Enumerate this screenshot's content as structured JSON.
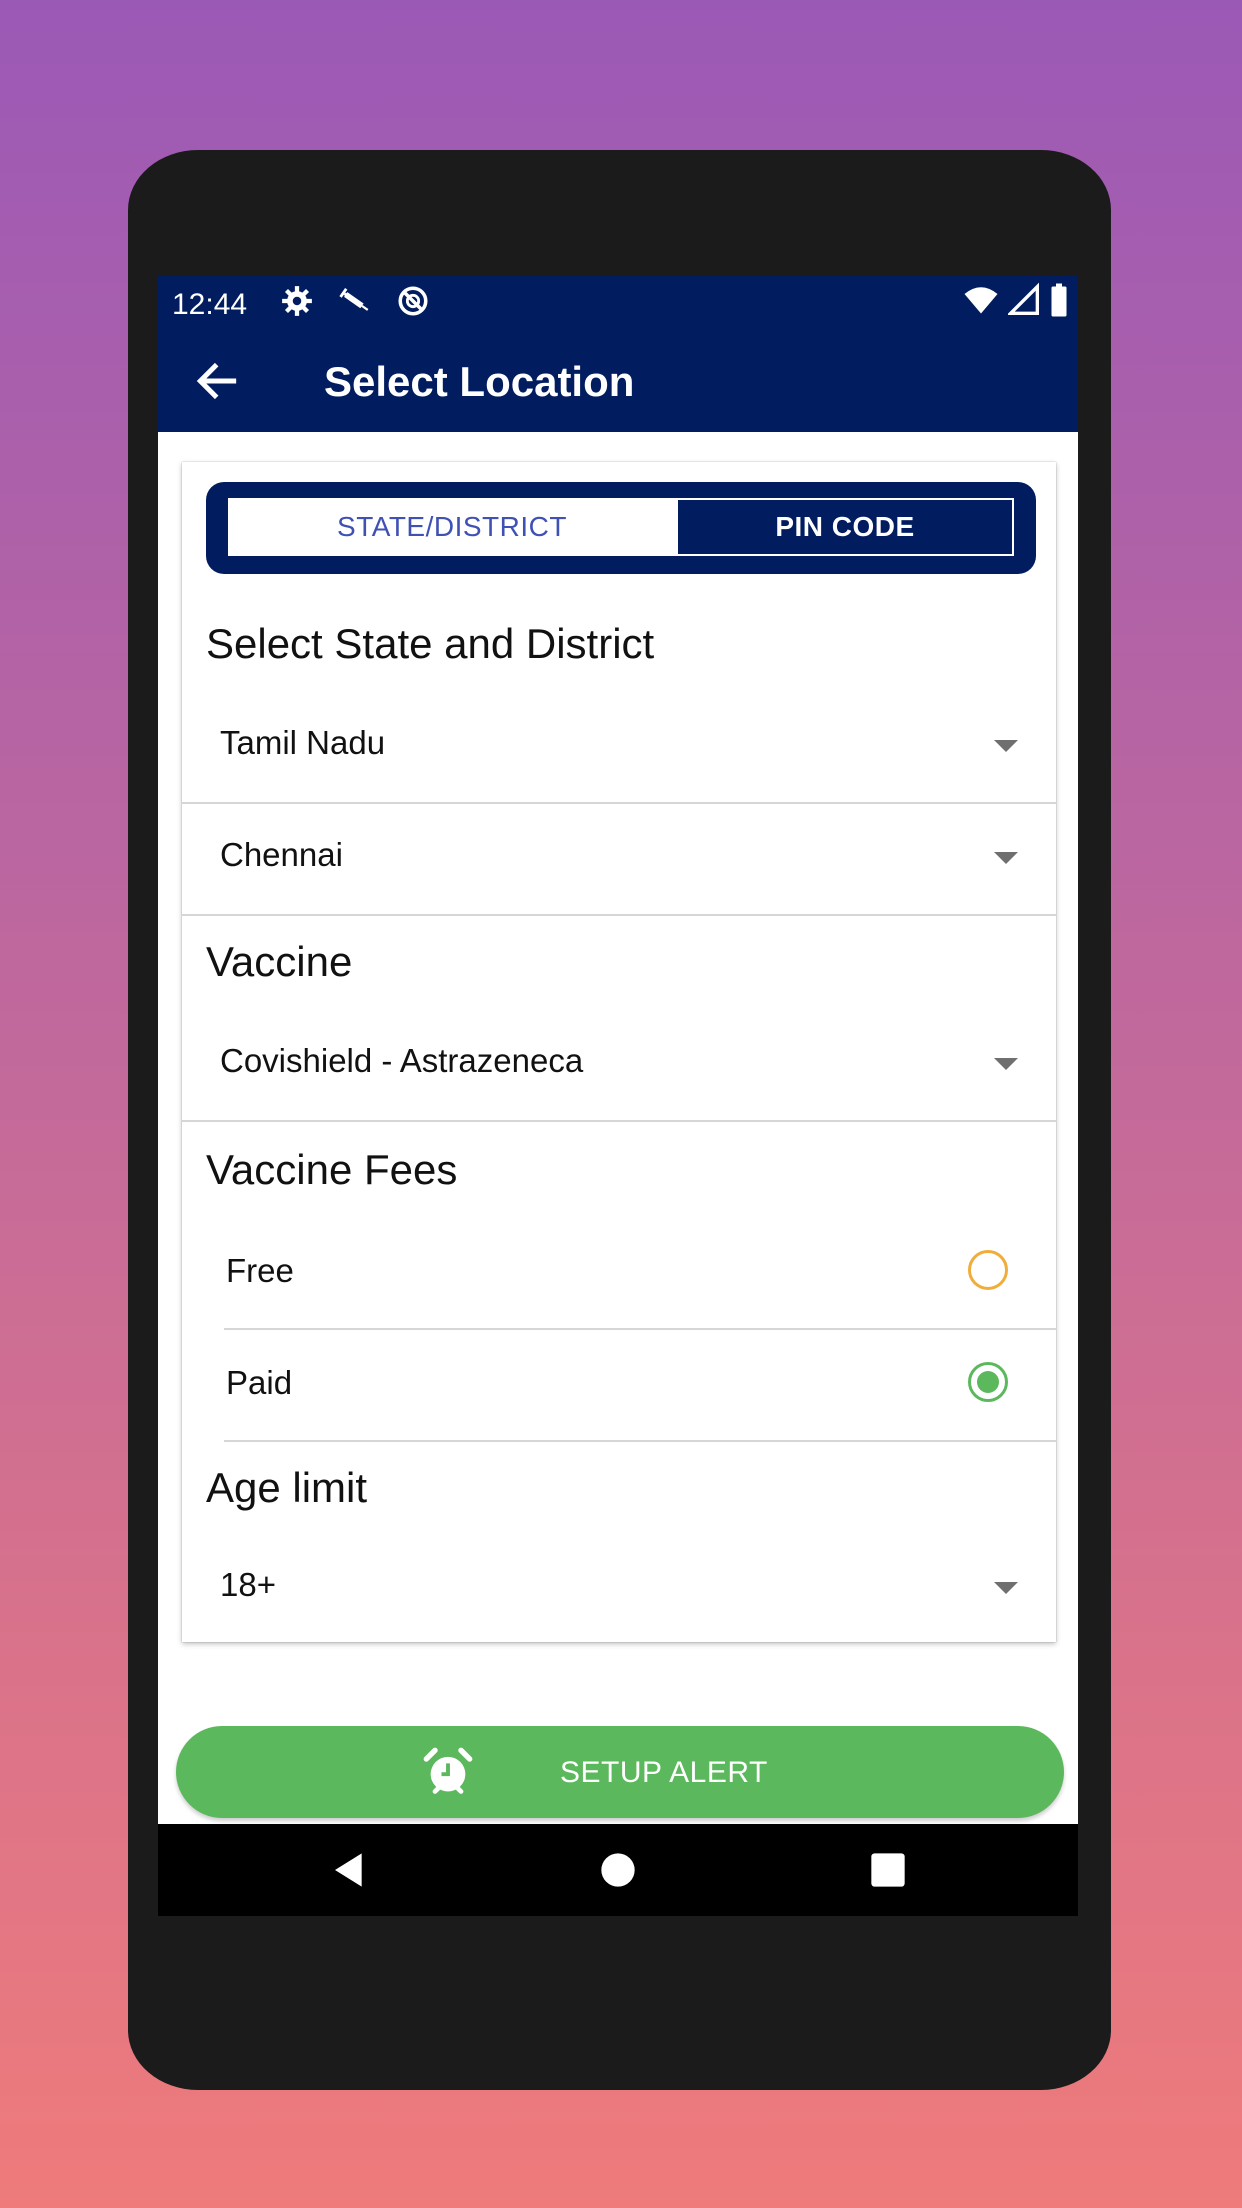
{
  "status_bar": {
    "time": "12:44",
    "icons_left": [
      "settings-icon",
      "vaccine-syringe-icon",
      "do-not-disturb-icon"
    ],
    "icons_right": [
      "wifi-icon",
      "cell-signal-icon",
      "battery-icon"
    ]
  },
  "app_bar": {
    "title": "Select Location",
    "back_icon": "arrow-left-icon"
  },
  "tabs": [
    {
      "label": "STATE/DISTRICT",
      "selected": true
    },
    {
      "label": "PIN CODE",
      "selected": false
    }
  ],
  "sections": {
    "state_district": {
      "heading": "Select State and District",
      "state_value": "Tamil Nadu",
      "district_value": "Chennai"
    },
    "vaccine": {
      "heading": "Vaccine",
      "value": "Covishield - Astrazeneca"
    },
    "fees": {
      "heading": "Vaccine Fees",
      "options": [
        {
          "label": "Free",
          "checked": false
        },
        {
          "label": "Paid",
          "checked": true
        }
      ]
    },
    "age": {
      "heading": "Age limit",
      "value": "18+"
    }
  },
  "button": {
    "label": "SETUP ALERT",
    "icon": "alarm-clock-icon"
  },
  "colors": {
    "primary": "#021d5f",
    "accent_green": "#5cb85c",
    "radio_unchecked": "#f0ad3c",
    "tab_text": "#3f51b5"
  },
  "nav_bar": [
    "back-triangle-icon",
    "home-circle-icon",
    "recents-square-icon"
  ]
}
